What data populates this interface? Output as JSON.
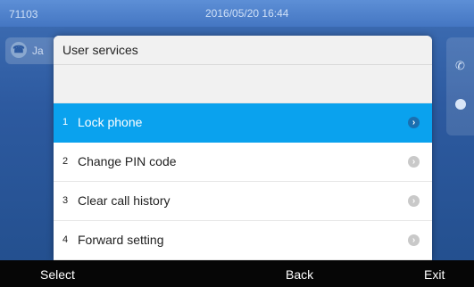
{
  "status": {
    "extension": "71103",
    "datetime": "2016/05/20 16:44"
  },
  "background": {
    "line_label": "Ja"
  },
  "dialog": {
    "title": "User services",
    "items": [
      {
        "num": "1",
        "label": "Lock phone",
        "selected": true
      },
      {
        "num": "2",
        "label": "Change PIN code",
        "selected": false
      },
      {
        "num": "3",
        "label": "Clear call history",
        "selected": false
      },
      {
        "num": "4",
        "label": "Forward setting",
        "selected": false
      }
    ]
  },
  "softkeys": {
    "select": "Select",
    "back": "Back",
    "exit": "Exit"
  },
  "colors": {
    "selected_bg": "#0aa2ee",
    "statusbar": "#4476c2",
    "softkey_bar": "#060606"
  },
  "icons": {
    "arrow": "chevron-right-icon",
    "handset": "handset-icon",
    "phone": "phone-icon"
  }
}
